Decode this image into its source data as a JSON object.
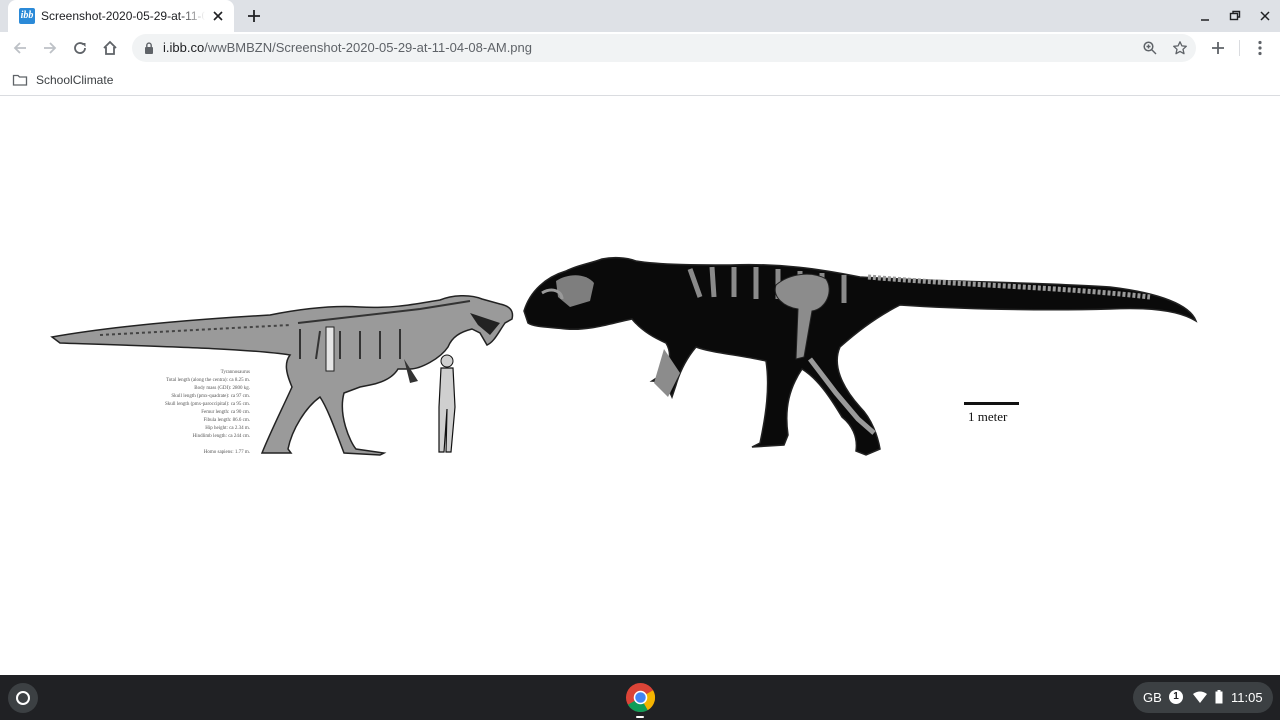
{
  "browser": {
    "tab": {
      "favicon_text": "ibb",
      "title": "Screenshot-2020-05-29-at-11-04-08-AM.png"
    },
    "omnibox": {
      "url_host": "i.ibb.co",
      "url_path": "/wwBMBZN/Screenshot-2020-05-29-at-11-04-08-AM.png"
    },
    "bookmarks": [
      {
        "label": "SchoolClimate",
        "icon": "folder-icon"
      }
    ],
    "icons": [
      "back-icon",
      "forward-icon",
      "reload-icon",
      "home-icon",
      "lock-icon",
      "zoom-icon",
      "star-icon",
      "extension-plus-icon",
      "menu-dots-icon"
    ]
  },
  "figure": {
    "scale_bar_label": "1 meter",
    "specimen_notes": [
      "Tyrannosaurus",
      "Total length (along the centra): ca 8.25 m.",
      "Body mass (GDI): 2800 kg.",
      "Skull length (pmx-quadrate): ca 97 cm.",
      "Skull length (pmx-paroccipital): ca 95 cm.",
      "Femur length: ca 90 cm.",
      "Fibula length: 86.6 cm.",
      "Hip height: ca 2.34 m.",
      "Hindlimb length: ca 244 cm.",
      "",
      "Homo sapiens: 1.77 m."
    ],
    "colors": {
      "bone": "#9a9a9a",
      "silhouette": "#0a0a0a",
      "outline": "#222222"
    }
  },
  "shelf": {
    "app": "chrome-icon",
    "tray": {
      "keyboard": "GB",
      "notifications": "1",
      "time": "11:05"
    }
  }
}
